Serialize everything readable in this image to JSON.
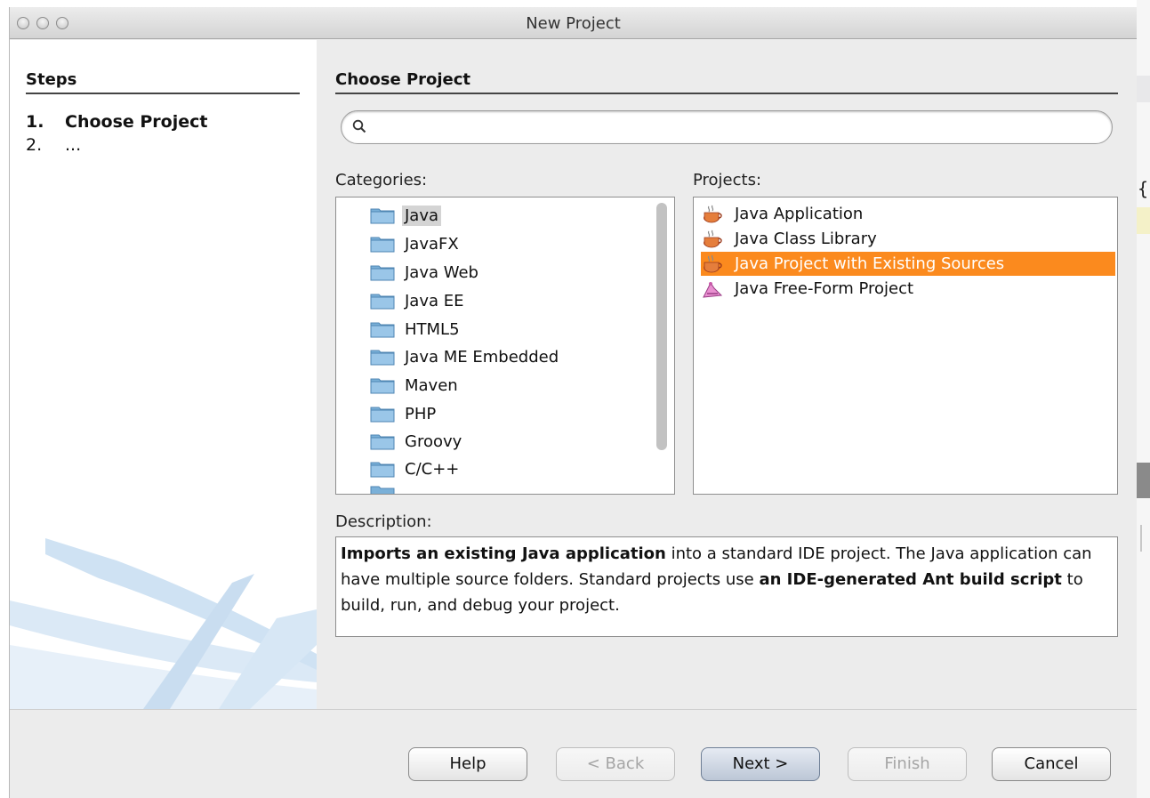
{
  "window": {
    "title": "New Project"
  },
  "steps": {
    "header": "Steps",
    "items": [
      {
        "num": "1.",
        "label": "Choose Project"
      },
      {
        "num": "2.",
        "label": "..."
      }
    ]
  },
  "main": {
    "header": "Choose Project",
    "search": {
      "value": "",
      "placeholder": ""
    },
    "categories_label": "Categories:",
    "projects_label": "Projects:",
    "description_label": "Description:"
  },
  "categories": [
    {
      "label": "Java",
      "selected": true
    },
    {
      "label": "JavaFX"
    },
    {
      "label": "Java Web"
    },
    {
      "label": "Java EE"
    },
    {
      "label": "HTML5"
    },
    {
      "label": "Java ME Embedded"
    },
    {
      "label": "Maven"
    },
    {
      "label": "PHP"
    },
    {
      "label": "Groovy"
    },
    {
      "label": "C/C++"
    }
  ],
  "projects": [
    {
      "label": "Java Application",
      "icon": "java-cup-icon"
    },
    {
      "label": "Java Class Library",
      "icon": "java-cup-icon"
    },
    {
      "label": "Java Project with Existing Sources",
      "icon": "java-cup-icon",
      "selected": true
    },
    {
      "label": "Java Free-Form Project",
      "icon": "free-form-icon"
    }
  ],
  "description": {
    "part1_bold": "Imports an existing Java application",
    "part2": " into a standard IDE project. The Java application can have multiple source folders. Standard projects use ",
    "part3_bold": "an IDE-generated Ant build script",
    "part4": " to build, run, and debug your project."
  },
  "buttons": {
    "help": "Help",
    "back": "< Back",
    "next": "Next >",
    "finish": "Finish",
    "cancel": "Cancel"
  },
  "behind": {
    "brace": "{"
  },
  "colors": {
    "selection": "#fb8a1e",
    "folder": "#7ab0d8"
  }
}
